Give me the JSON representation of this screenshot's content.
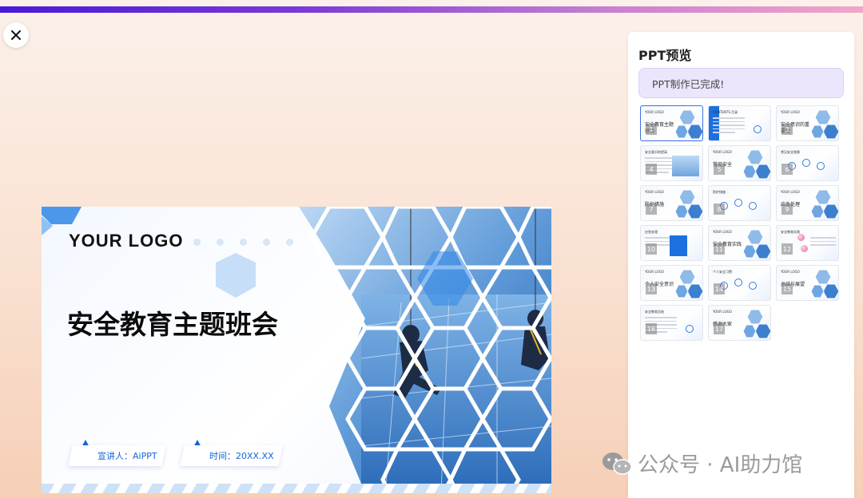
{
  "progress": 1.0,
  "colors": {
    "accent": "#3b6fe3",
    "brand_blue": "#1466d6",
    "progress_start": "#4a19d8",
    "progress_end": "#f2a6c8"
  },
  "icons": {
    "close": "close-icon",
    "speaker": "speaker-icon",
    "calendar": "calendar-icon",
    "wechat": "wechat-icon"
  },
  "slide": {
    "logo": "YOUR LOGO",
    "title": "安全教育主题班会",
    "speaker": "宣讲人：AiPPT",
    "time": "时间：20XX.XX"
  },
  "panel": {
    "title": "PPT预览",
    "status": "PPT制作已完成!",
    "thumbnails": [
      {
        "num": "1",
        "label": "YOUR LOGO",
        "title": "安全教育主题班会"
      },
      {
        "num": "2",
        "label": "CONTENTS 目录",
        "title": ""
      },
      {
        "num": "3",
        "label": "YOUR LOGO",
        "title": "安全意识的重要性"
      },
      {
        "num": "4",
        "label": "安全意识的提高",
        "title": ""
      },
      {
        "num": "5",
        "label": "YOUR LOGO",
        "title": "常见安全"
      },
      {
        "num": "6",
        "label": "常见安全隐患",
        "title": ""
      },
      {
        "num": "7",
        "label": "YOUR LOGO",
        "title": "防护措施"
      },
      {
        "num": "8",
        "label": "防护措施",
        "title": ""
      },
      {
        "num": "9",
        "label": "YOUR LOGO",
        "title": "应急处理"
      },
      {
        "num": "10",
        "label": "应急处理",
        "title": ""
      },
      {
        "num": "11",
        "label": "YOUR LOGO",
        "title": "安全教育实践"
      },
      {
        "num": "12",
        "label": "安全教育实践",
        "title": ""
      },
      {
        "num": "13",
        "label": "YOUR LOGO",
        "title": "个人安全意识"
      },
      {
        "num": "14",
        "label": "个人安全习惯",
        "title": ""
      },
      {
        "num": "15",
        "label": "YOUR LOGO",
        "title": "总结与展望"
      },
      {
        "num": "16",
        "label": "安全教育总结",
        "title": ""
      },
      {
        "num": "17",
        "label": "YOUR LOGO",
        "title": "感谢大家"
      }
    ]
  },
  "watermark": "公众号 · AI助力馆"
}
